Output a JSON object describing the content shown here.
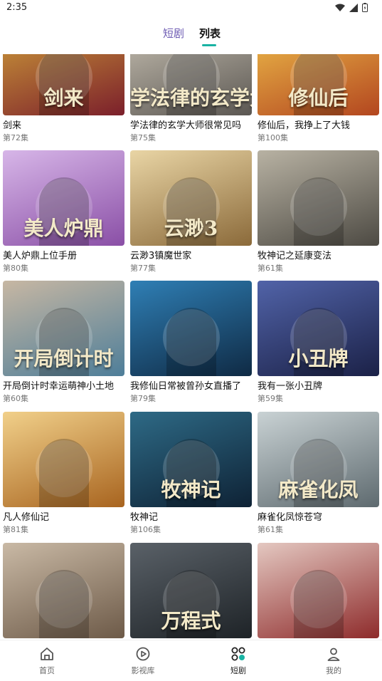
{
  "status_bar": {
    "time": "2:35"
  },
  "tabs": [
    {
      "label": "短剧"
    },
    {
      "label": "列表"
    }
  ],
  "dramas": [
    {
      "title": "剑来",
      "episodes": "第72集",
      "poster_text": "剑来",
      "colors": [
        "#7b1f2b",
        "#d0a03a"
      ]
    },
    {
      "title": "学法律的玄学大师很常见吗",
      "episodes": "第75集",
      "poster_text": "学法律的玄学大师",
      "colors": [
        "#5b5752",
        "#c9c2b4"
      ]
    },
    {
      "title": "修仙后，我挣上了大钱",
      "episodes": "第100集",
      "poster_text": "修仙后",
      "colors": [
        "#b3461f",
        "#f0c24c"
      ]
    },
    {
      "title": "美人炉鼎上位手册",
      "episodes": "第80集",
      "poster_text": "美人炉鼎",
      "colors": [
        "#8a4fa6",
        "#d7b6e8"
      ]
    },
    {
      "title": "云渺3镇魔世家",
      "episodes": "第77集",
      "poster_text": "云渺3",
      "colors": [
        "#8b6a3a",
        "#e9d5a5"
      ]
    },
    {
      "title": "牧神记之延康变法",
      "episodes": "第61集",
      "poster_text": "",
      "colors": [
        "#4d4a43",
        "#b8b2a3"
      ]
    },
    {
      "title": "开局倒计时幸运萌神小土地",
      "episodes": "第60集",
      "poster_text": "开局倒计时",
      "colors": [
        "#4e7e99",
        "#c7b7a3"
      ]
    },
    {
      "title": "我修仙日常被曾孙女直播了",
      "episodes": "第79集",
      "poster_text": "",
      "colors": [
        "#0f2a44",
        "#2f7fb5"
      ]
    },
    {
      "title": "我有一张小丑牌",
      "episodes": "第59集",
      "poster_text": "小丑牌",
      "colors": [
        "#1b2147",
        "#5163a8"
      ]
    },
    {
      "title": "凡人修仙记",
      "episodes": "第81集",
      "poster_text": "",
      "colors": [
        "#a8641f",
        "#f1d08a"
      ]
    },
    {
      "title": "牧神记",
      "episodes": "第106集",
      "poster_text": "牧神记",
      "colors": [
        "#0e2235",
        "#2e6a86"
      ]
    },
    {
      "title": "麻雀化凤惊苍穹",
      "episodes": "第61集",
      "poster_text": "麻雀化凤",
      "colors": [
        "#5e6a6f",
        "#c9d2d4"
      ]
    },
    {
      "title": "",
      "episodes": "",
      "poster_text": "",
      "colors": [
        "#6d5a48",
        "#c9b9a5"
      ]
    },
    {
      "title": "",
      "episodes": "",
      "poster_text": "万程式",
      "colors": [
        "#1e2327",
        "#5a6168"
      ]
    },
    {
      "title": "",
      "episodes": "",
      "poster_text": "",
      "colors": [
        "#8e2b2b",
        "#e4c8c1"
      ]
    }
  ],
  "bottom_nav": [
    {
      "label": "首页",
      "icon": "home-icon"
    },
    {
      "label": "影视库",
      "icon": "play-circle-icon"
    },
    {
      "label": "短剧",
      "icon": "grid-icon"
    },
    {
      "label": "我的",
      "icon": "user-icon"
    }
  ],
  "colors": {
    "accent": "#19b3a3",
    "tab_inactive": "#6d5bb3"
  }
}
